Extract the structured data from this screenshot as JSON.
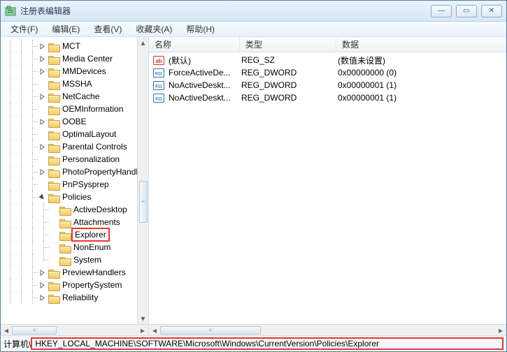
{
  "window": {
    "title": "注册表编辑器"
  },
  "title_buttons": {
    "minimize": "—",
    "maximize": "▭",
    "close": "✕"
  },
  "menu": {
    "file": "文件(F)",
    "edit": "编辑(E)",
    "view": "查看(V)",
    "favorites": "收藏夹(A)",
    "help": "帮助(H)"
  },
  "tree": [
    {
      "name": "MCT",
      "depth": 3,
      "expandable": true,
      "expanded": false
    },
    {
      "name": "Media Center",
      "depth": 3,
      "expandable": true,
      "expanded": false
    },
    {
      "name": "MMDevices",
      "depth": 3,
      "expandable": true,
      "expanded": false
    },
    {
      "name": "MSSHA",
      "depth": 3,
      "expandable": false
    },
    {
      "name": "NetCache",
      "depth": 3,
      "expandable": true,
      "expanded": false
    },
    {
      "name": "OEMInformation",
      "depth": 3,
      "expandable": false
    },
    {
      "name": "OOBE",
      "depth": 3,
      "expandable": true,
      "expanded": false
    },
    {
      "name": "OptimalLayout",
      "depth": 3,
      "expandable": false
    },
    {
      "name": "Parental Controls",
      "depth": 3,
      "expandable": true,
      "expanded": false
    },
    {
      "name": "Personalization",
      "depth": 3,
      "expandable": false
    },
    {
      "name": "PhotoPropertyHandler",
      "depth": 3,
      "expandable": true,
      "expanded": false
    },
    {
      "name": "PnPSysprep",
      "depth": 3,
      "expandable": false
    },
    {
      "name": "Policies",
      "depth": 3,
      "expandable": true,
      "expanded": true
    },
    {
      "name": "ActiveDesktop",
      "depth": 4,
      "expandable": false
    },
    {
      "name": "Attachments",
      "depth": 4,
      "expandable": false
    },
    {
      "name": "Explorer",
      "depth": 4,
      "expandable": false,
      "selected": true
    },
    {
      "name": "NonEnum",
      "depth": 4,
      "expandable": false
    },
    {
      "name": "System",
      "depth": 4,
      "expandable": false,
      "lastSibling": true
    },
    {
      "name": "PreviewHandlers",
      "depth": 3,
      "expandable": true,
      "expanded": false
    },
    {
      "name": "PropertySystem",
      "depth": 3,
      "expandable": true,
      "expanded": false
    },
    {
      "name": "Reliability",
      "depth": 3,
      "expandable": true,
      "expanded": false
    }
  ],
  "columns": {
    "name": "名称",
    "type": "类型",
    "data": "数据"
  },
  "values": [
    {
      "icon": "sz",
      "name": "(默认)",
      "type": "REG_SZ",
      "data": "(数值未设置)"
    },
    {
      "icon": "dw",
      "name": "ForceActiveDe...",
      "type": "REG_DWORD",
      "data": "0x00000000 (0)"
    },
    {
      "icon": "dw",
      "name": "NoActiveDeskt...",
      "type": "REG_DWORD",
      "data": "0x00000001 (1)"
    },
    {
      "icon": "dw",
      "name": "NoActiveDeskt...",
      "type": "REG_DWORD",
      "data": "0x00000001 (1)"
    }
  ],
  "status": {
    "label": "计算机\\",
    "path": "HKEY_LOCAL_MACHINE\\SOFTWARE\\Microsoft\\Windows\\CurrentVersion\\Policies\\Explorer"
  },
  "scroll_grip": "≡"
}
